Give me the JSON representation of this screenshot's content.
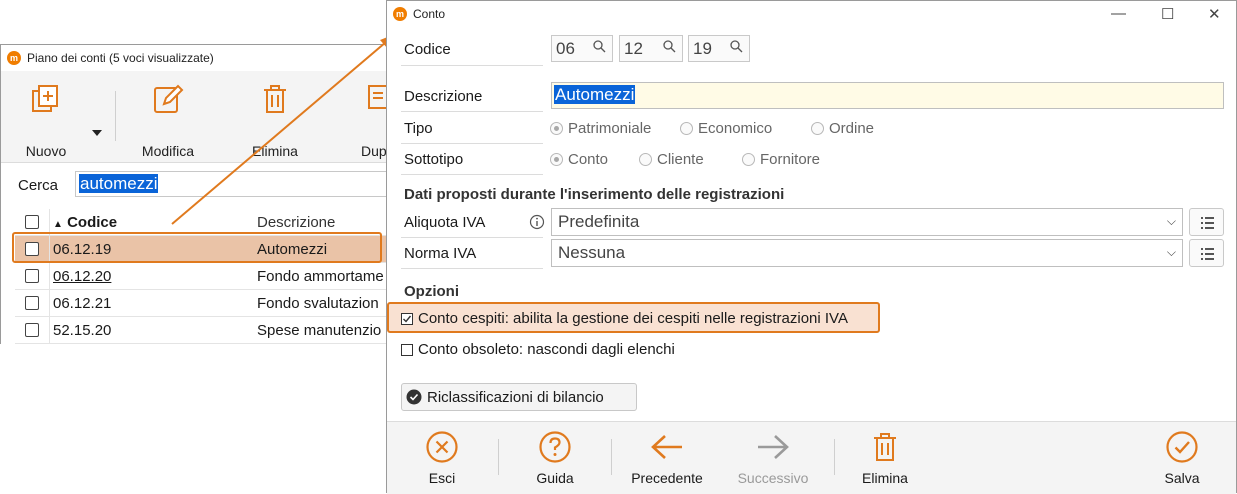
{
  "back_window": {
    "title": "Piano dei conti (5 voci visualizzate)",
    "toolbar": {
      "nuovo": "Nuovo",
      "modifica": "Modifica",
      "elimina": "Elimina",
      "duplica": "Dupl"
    },
    "search": {
      "label": "Cerca",
      "value": "automezzi"
    },
    "table": {
      "headers": [
        "Codice",
        "Descrizione"
      ],
      "rows": [
        {
          "codice": "06.12.19",
          "descrizione": "Automezzi"
        },
        {
          "codice": "06.12.20",
          "descrizione": "Fondo ammortame"
        },
        {
          "codice": "06.12.21",
          "descrizione": "Fondo svalutazion"
        },
        {
          "codice": "52.15.20",
          "descrizione": "Spese manutenzio"
        }
      ]
    }
  },
  "front_window": {
    "title": "Conto",
    "codice": {
      "label": "Codice",
      "parts": [
        "06",
        "12",
        "19"
      ]
    },
    "descrizione": {
      "label": "Descrizione",
      "value": "Automezzi"
    },
    "tipo": {
      "label": "Tipo",
      "options": [
        "Patrimoniale",
        "Economico",
        "Ordine"
      ],
      "selected": "Patrimoniale"
    },
    "sottotipo": {
      "label": "Sottotipo",
      "options": [
        "Conto",
        "Cliente",
        "Fornitore"
      ],
      "selected": "Conto"
    },
    "dati_section": "Dati proposti durante l'inserimento delle registrazioni",
    "aliquota": {
      "label": "Aliquota IVA",
      "value": "Predefinita"
    },
    "norma": {
      "label": "Norma IVA",
      "value": "Nessuna"
    },
    "opzioni_section": "Opzioni",
    "conto_cespiti": {
      "label": "Conto cespiti: abilita la gestione dei cespiti nelle registrazioni IVA",
      "checked": true
    },
    "conto_obsoleto": {
      "label": "Conto obsoleto: nascondi dagli elenchi",
      "checked": false
    },
    "riclassificazioni": "Riclassificazioni di bilancio",
    "footer": {
      "esci": "Esci",
      "guida": "Guida",
      "precedente": "Precedente",
      "successivo": "Successivo",
      "elimina": "Elimina",
      "salva": "Salva"
    },
    "colors": {
      "accent": "#e07a1e",
      "disabled": "#9a9a9a"
    }
  }
}
